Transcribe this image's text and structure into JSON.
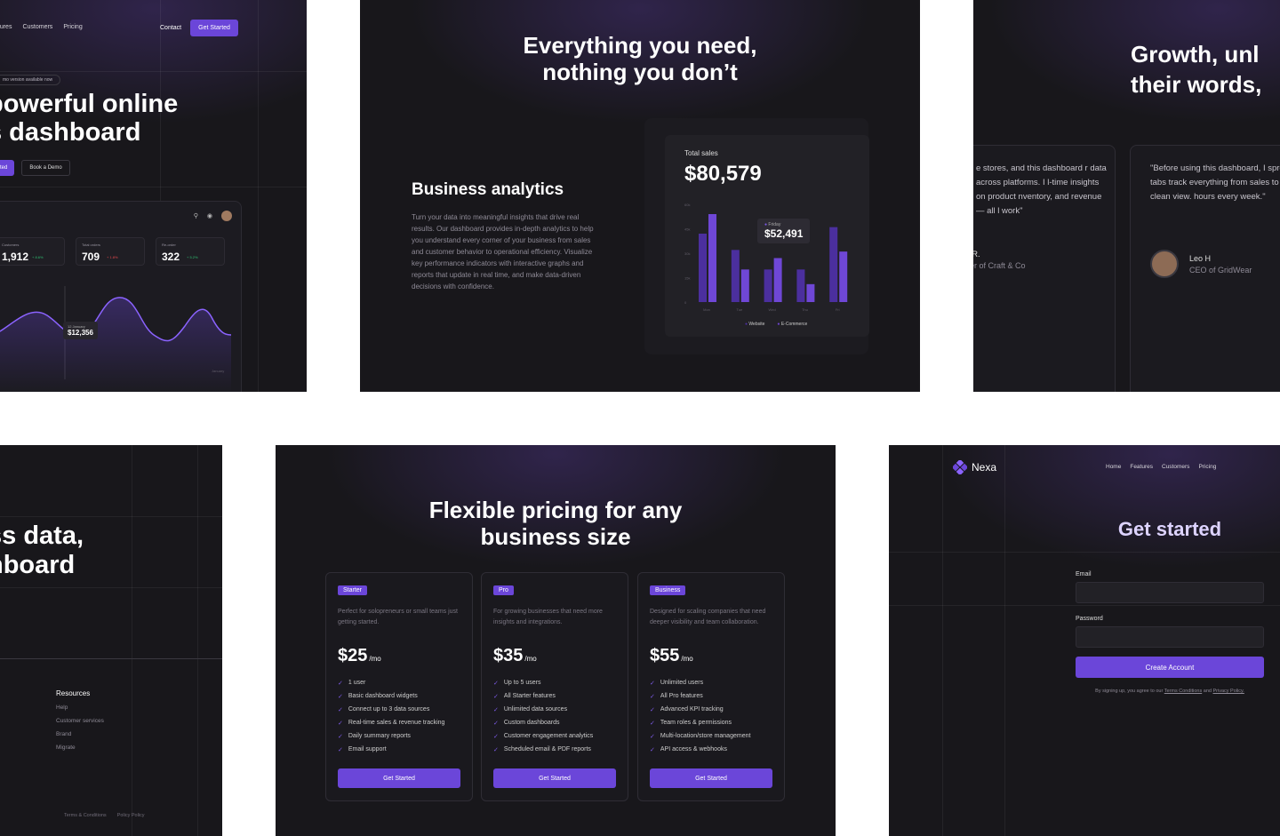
{
  "panel1": {
    "nav": [
      "atures",
      "Customers",
      "Pricing"
    ],
    "contact": "Contact",
    "get_started": "Get Started",
    "pill": "mo version available now",
    "hero_line1": "powerful online",
    "hero_line2": "s dashboard",
    "btn_started": "rted",
    "btn_demo": "Book a Demo",
    "stats": [
      {
        "label": "Customers",
        "value": "1,912",
        "change": "+ 8.6%",
        "color": "#2fbf71"
      },
      {
        "label": "Total orders",
        "value": "709",
        "change": "+ 1.8%",
        "color": "#e5484d"
      },
      {
        "label": "Re-order",
        "value": "322",
        "change": "+ 5.2%",
        "color": "#2fbf71"
      }
    ],
    "tooltip_label": "12 January",
    "tooltip_value": "$12,356",
    "corner_label": "January"
  },
  "panel2": {
    "title_line1": "Everything you need,",
    "title_line2": "nothing you don’t",
    "subtitle": "Business analytics",
    "description": "Turn your data into meaningful insights that drive real results. Our dashboard provides in-depth analytics to help you understand every corner of your business from sales and customer behavior to operational efficiency. Visualize key performance indicators with interactive graphs and reports that update in real time, and make data-driven decisions with confidence.",
    "card_label": "Total sales",
    "card_amount": "$80,579",
    "tooltip_day": "Friday",
    "tooltip_value": "$52,491",
    "legend": [
      "Website",
      "E-Commerce"
    ]
  },
  "chart_data": {
    "type": "bar",
    "categories": [
      "Mon",
      "Tue",
      "Wed",
      "Thu",
      "Fri"
    ],
    "series": [
      {
        "name": "Website",
        "values": [
          42,
          32,
          20,
          20,
          46
        ]
      },
      {
        "name": "E-Commerce",
        "values": [
          54,
          20,
          27,
          11,
          31
        ]
      }
    ],
    "yticks": [
      "60k",
      "45k",
      "30k",
      "15k",
      "0"
    ],
    "ylim": [
      0,
      60
    ],
    "colors": {
      "Website": "#4b2f9e",
      "E-Commerce": "#6f47d6"
    }
  },
  "panel3": {
    "title_line1": "Growth, unl",
    "title_line2": "their words,",
    "testimonials": [
      {
        "quote": "e stores, and this dashboard r data across platforms. I l-time insights on product nventory, and revenue — all l work\"",
        "name": "a R.",
        "role": "der of Craft & Co"
      },
      {
        "quote": "\"Before using this dashboard, I spreadsheets and browser tabs track everything from sales to c engagement in one clean view. hours every week.\"",
        "name": "Leo H",
        "role": "CEO of GridWear"
      }
    ]
  },
  "panel4": {
    "title_line1": "ss data,",
    "title_line2": "hboard",
    "resources_head": "Resources",
    "resources": [
      "Help",
      "Customer services",
      "Brand",
      "Migrate"
    ],
    "terms": "Terms & Conditions",
    "policy": "Policy Policy"
  },
  "panel5": {
    "title_line1": "Flexible pricing for any",
    "title_line2": "business size",
    "plans": [
      {
        "name": "Starter",
        "desc": "Perfect for solopreneurs or small teams just getting started.",
        "price": "$25",
        "per": "/mo",
        "features": [
          "1 user",
          "Basic dashboard widgets",
          "Connect up to 3 data sources",
          "Real-time sales & revenue tracking",
          "Daily summary reports",
          "Email support"
        ],
        "cta": "Get Started"
      },
      {
        "name": "Pro",
        "desc": "For growing businesses that need more insights and integrations.",
        "price": "$35",
        "per": "/mo",
        "features": [
          "Up to 5 users",
          "All Starter features",
          "Unlimited data sources",
          "Custom dashboards",
          "Customer engagement analytics",
          "Scheduled email & PDF reports"
        ],
        "cta": "Get Started"
      },
      {
        "name": "Business",
        "desc": "Designed for scaling companies that need deeper visibility and team collaboration.",
        "price": "$55",
        "per": "/mo",
        "features": [
          "Unlimited users",
          "All Pro features",
          "Advanced KPI tracking",
          "Team roles & permissions",
          "Multi-location/store management",
          "API access & webhooks"
        ],
        "cta": "Get Started"
      }
    ]
  },
  "panel6": {
    "logo": "Nexa",
    "nav": [
      "Home",
      "Features",
      "Customers",
      "Pricing"
    ],
    "title": "Get started",
    "email_label": "Email",
    "password_label": "Password",
    "create": "Create Account",
    "terms_prefix": "By signing up, you agree to our",
    "terms_link": "Terms Conditions",
    "terms_and": "and",
    "privacy_link": "Privacy Policy."
  }
}
